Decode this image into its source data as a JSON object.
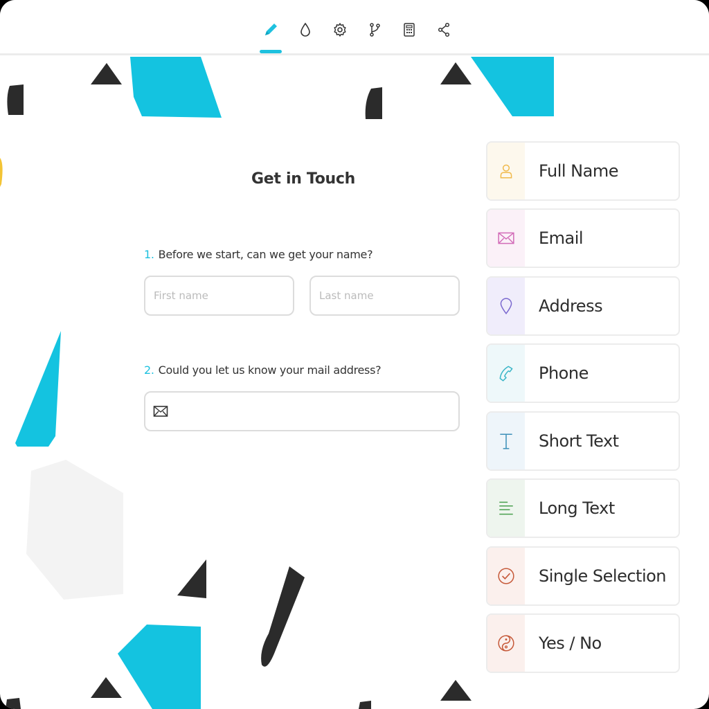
{
  "toolbar": {
    "tools": [
      {
        "name": "pencil-icon",
        "active": true
      },
      {
        "name": "droplet-icon"
      },
      {
        "name": "gear-icon"
      },
      {
        "name": "branch-icon"
      },
      {
        "name": "calculator-icon"
      },
      {
        "name": "share-icon"
      }
    ],
    "accent_color": "#1ec1df"
  },
  "form": {
    "title": "Get in Touch",
    "q1": {
      "number": "1.",
      "text": "Before we start, can we get your name?"
    },
    "first_name_placeholder": "First name",
    "last_name_placeholder": "Last name",
    "q2": {
      "number": "2.",
      "text": "Could you let us know your mail address?"
    },
    "email_icon": "mail-icon"
  },
  "palette": {
    "items": [
      {
        "label": "Full Name",
        "icon": "user-icon",
        "bg": "#fdf8ed",
        "color": "#f0b94a"
      },
      {
        "label": "Email",
        "icon": "mail-icon",
        "bg": "#fbf1f8",
        "color": "#d26bb8"
      },
      {
        "label": "Address",
        "icon": "location-pin-icon",
        "bg": "#f0edfb",
        "color": "#7b69cf"
      },
      {
        "label": "Phone",
        "icon": "phone-icon",
        "bg": "#eef8fa",
        "color": "#3ab5c7"
      },
      {
        "label": "Short Text",
        "icon": "text-icon",
        "bg": "#eef5fa",
        "color": "#3c8fb8"
      },
      {
        "label": "Long Text",
        "icon": "paragraph-icon",
        "bg": "#eef5ee",
        "color": "#4aa04e"
      },
      {
        "label": "Single Selection",
        "icon": "check-circle-icon",
        "bg": "#fbf0ed",
        "color": "#c65a3a"
      },
      {
        "label": "Yes / No",
        "icon": "yin-yang-icon",
        "bg": "#fbf0ed",
        "color": "#c65a3a"
      }
    ]
  }
}
